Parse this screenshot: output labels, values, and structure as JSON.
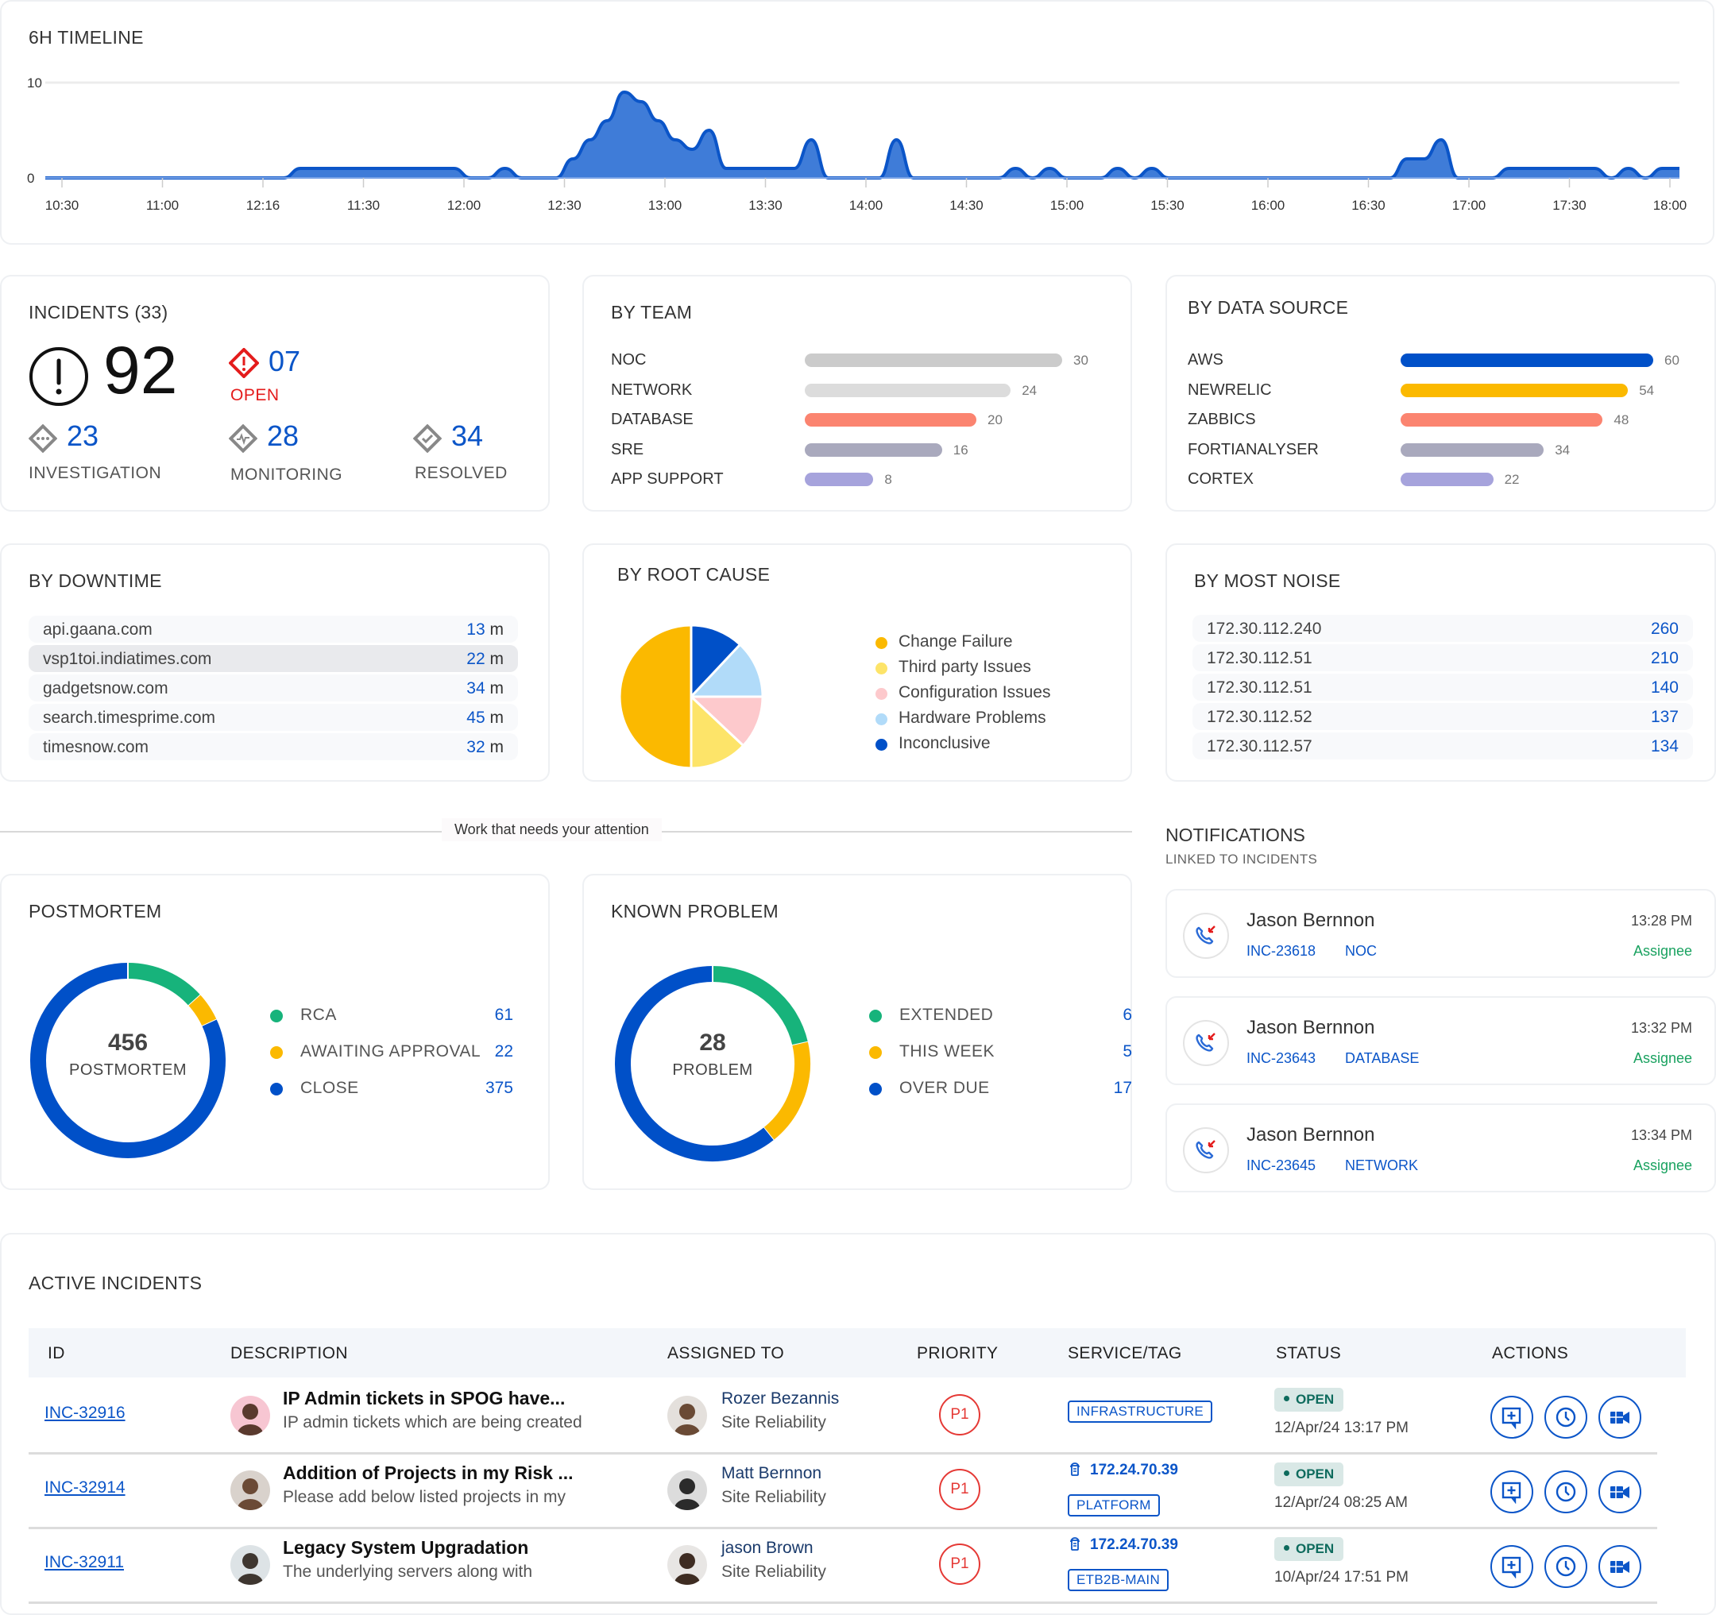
{
  "timeline": {
    "title": "6H TIMELINE",
    "chart_data": {
      "type": "area",
      "title": "6H TIMELINE",
      "xlabel": "",
      "ylabel": "",
      "ylim": [
        0,
        10
      ],
      "yticks": [
        "0",
        "10"
      ],
      "x_tick_labels": [
        "10:30",
        "11:00",
        "12:16",
        "11:30",
        "12:00",
        "12:30",
        "13:00",
        "13:30",
        "14:00",
        "14:30",
        "15:00",
        "15:30",
        "16:00",
        "16:30",
        "17:00",
        "17:30",
        "18:00"
      ],
      "grid": true,
      "series": [
        {
          "name": "incidents",
          "color": "#0b55c8",
          "values": [
            0,
            0,
            0,
            0,
            0,
            0,
            0,
            0,
            0,
            0,
            0,
            0,
            0,
            0,
            0,
            1,
            1,
            1,
            1,
            1,
            1,
            1,
            1,
            1,
            1,
            0,
            0,
            1,
            0,
            0,
            0,
            2,
            4,
            6,
            9,
            8,
            6,
            4,
            3,
            5,
            1,
            1,
            1,
            1,
            1,
            4,
            0,
            0,
            0,
            0,
            4,
            0,
            0,
            0,
            0,
            0,
            0,
            1,
            0,
            1,
            0,
            0,
            0,
            1,
            0,
            1,
            0,
            0,
            0,
            0,
            0,
            0,
            0,
            0,
            0,
            0,
            0,
            0,
            0,
            0,
            2,
            2,
            4,
            0,
            0,
            0,
            1,
            1,
            1,
            1,
            1,
            1,
            0,
            1,
            0,
            1,
            1
          ]
        }
      ]
    }
  },
  "incidents": {
    "title": "INCIDENTS (33)",
    "total": "92",
    "open_count": "07",
    "open_label": "OPEN",
    "stats": [
      {
        "value": "23",
        "label": "INVESTIGATION"
      },
      {
        "value": "28",
        "label": "MONITORING"
      },
      {
        "value": "34",
        "label": "RESOLVED"
      }
    ]
  },
  "by_team": {
    "title": "BY TEAM",
    "chart_data": {
      "type": "bar",
      "orientation": "horizontal",
      "categories": [
        "NOC",
        "NETWORK",
        "DATABASE",
        "SRE",
        "APP SUPPORT"
      ],
      "values": [
        30,
        24,
        20,
        16,
        8
      ],
      "colors": [
        "#cbcbcb",
        "#dcdcdc",
        "#fb8470",
        "#a9a9bd",
        "#a6a3dc"
      ]
    }
  },
  "by_source": {
    "title": "BY DATA SOURCE",
    "chart_data": {
      "type": "bar",
      "orientation": "horizontal",
      "categories": [
        "AWS",
        "NEWRELIC",
        "ZABBICS",
        "FORTIANALYSER",
        "CORTEX"
      ],
      "values": [
        60,
        54,
        48,
        34,
        22
      ],
      "colors": [
        "#0050c8",
        "#fbb900",
        "#fb8470",
        "#a9a9bd",
        "#a6a3dc"
      ]
    }
  },
  "by_downtime": {
    "title": "BY DOWNTIME",
    "unit": "m",
    "rows": [
      {
        "host": "api.gaana.com",
        "value": "13"
      },
      {
        "host": "vsp1toi.indiatimes.com",
        "value": "22"
      },
      {
        "host": "gadgetsnow.com",
        "value": "34"
      },
      {
        "host": "search.timesprime.com",
        "value": "45"
      },
      {
        "host": "timesnow.com",
        "value": "32"
      }
    ]
  },
  "by_root_cause": {
    "title": "BY ROOT CAUSE",
    "chart_data": {
      "type": "pie",
      "categories": [
        "Change Failure",
        "Third party Issues",
        "Configuration Issues",
        "Hardware Problems",
        "Inconclusive"
      ],
      "values": [
        50,
        13,
        12,
        13,
        12
      ],
      "colors": [
        "#fbb900",
        "#fde469",
        "#fdc9cc",
        "#b1dbf9",
        "#0050c8"
      ]
    }
  },
  "by_noise": {
    "title": "BY MOST NOISE",
    "rows": [
      {
        "ip": "172.30.112.240",
        "value": "260"
      },
      {
        "ip": "172.30.112.51",
        "value": "210"
      },
      {
        "ip": "172.30.112.51",
        "value": "140"
      },
      {
        "ip": "172.30.112.52",
        "value": "137"
      },
      {
        "ip": "172.30.112.57",
        "value": "134"
      }
    ]
  },
  "divider_label": "Work that needs your attention",
  "postmortem": {
    "title": "POSTMORTEM",
    "center_value": "456",
    "center_label": "POSTMORTEM",
    "chart_data": {
      "type": "pie",
      "variant": "donut",
      "categories": [
        "RCA",
        "AWAITING APPROVAL",
        "CLOSE"
      ],
      "values": [
        61,
        22,
        375
      ],
      "value_labels": [
        "61",
        "22",
        "375"
      ],
      "colors": [
        "#17b37b",
        "#fbb900",
        "#0050c8"
      ]
    }
  },
  "known_problem": {
    "title": "KNOWN PROBLEM",
    "center_value": "28",
    "center_label": "PROBLEM",
    "chart_data": {
      "type": "pie",
      "variant": "donut",
      "categories": [
        "EXTENDED",
        "THIS WEEK",
        "OVER DUE"
      ],
      "values": [
        6,
        5,
        17
      ],
      "value_labels": [
        "6",
        "5",
        "17"
      ],
      "colors": [
        "#17b37b",
        "#fbb900",
        "#0050c8"
      ]
    }
  },
  "notifications": {
    "title": "NOTIFICATIONS",
    "subtitle": "LINKED TO INCIDENTS",
    "items": [
      {
        "name": "Jason Bernnon",
        "incident": "INC-23618",
        "team": "NOC",
        "time": "13:28 PM",
        "role": "Assignee"
      },
      {
        "name": "Jason Bernnon",
        "incident": "INC-23643",
        "team": "DATABASE",
        "time": "13:32 PM",
        "role": "Assignee"
      },
      {
        "name": "Jason Bernnon",
        "incident": "INC-23645",
        "team": "NETWORK",
        "time": "13:34 PM",
        "role": "Assignee"
      }
    ]
  },
  "active_incidents": {
    "title": "ACTIVE INCIDENTS",
    "columns": [
      "ID",
      "DESCRIPTION",
      "ASSIGNED TO",
      "PRIORITY",
      "SERVICE/TAG",
      "STATUS",
      "ACTIONS"
    ],
    "rows": [
      {
        "id": "INC-32916",
        "title": "IP Admin tickets in SPOG have...",
        "summary": "IP admin tickets which are being created",
        "assignee": "Rozer Bezannis",
        "team": "Site Reliability",
        "priority": "P1",
        "ip": "",
        "tag": "INFRASTRUCTURE",
        "status": "OPEN",
        "date": "12/Apr/24 13:17 PM"
      },
      {
        "id": "INC-32914",
        "title": "Addition of Projects in my Risk ...",
        "summary": "Please add below listed projects in my",
        "assignee": "Matt Bernnon",
        "team": "Site Reliability",
        "priority": "P1",
        "ip": "172.24.70.39",
        "tag": "PLATFORM",
        "status": "OPEN",
        "date": "12/Apr/24 08:25 AM"
      },
      {
        "id": "INC-32911",
        "title": "Legacy System Upgradation",
        "summary": "The underlying servers along with",
        "assignee": "jason Brown",
        "team": "Site Reliability",
        "priority": "P1",
        "ip": "172.24.70.39",
        "tag": "ETB2B-MAIN",
        "status": "OPEN",
        "date": "10/Apr/24 17:51 PM"
      }
    ]
  }
}
